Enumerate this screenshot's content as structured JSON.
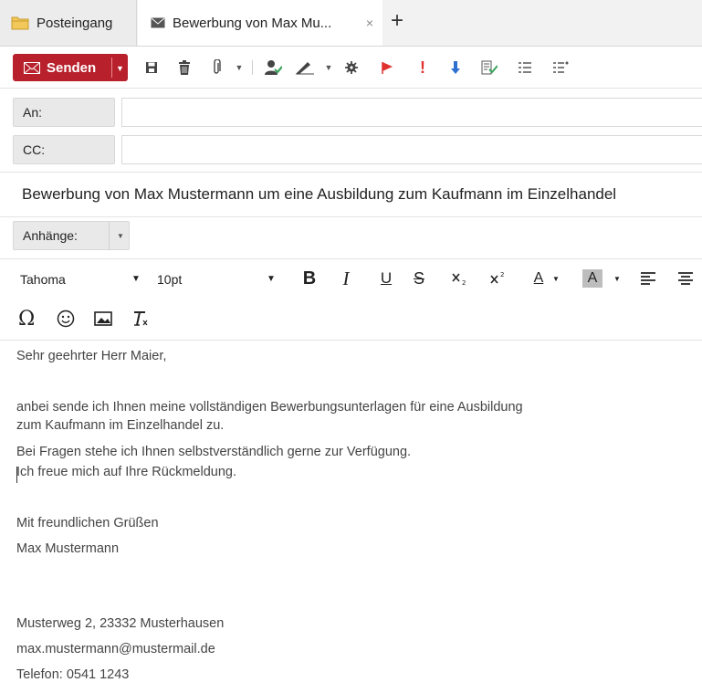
{
  "tabs": [
    {
      "label": "Posteingang",
      "icon": "folder-icon"
    },
    {
      "label": "Bewerbung von Max Mu...",
      "icon": "envelope-icon",
      "close": "×"
    }
  ],
  "new_tab": "+",
  "toolbar": {
    "send_label": "Senden",
    "icons": [
      "save-icon",
      "trash-icon",
      "paperclip-icon",
      "contact-icon",
      "signature-icon",
      "settings-icon",
      "flag-icon",
      "priority-high-icon",
      "priority-low-icon",
      "receipt-icon",
      "list-icon",
      "list-settings-icon"
    ]
  },
  "recipients": {
    "to_label": "An:",
    "to_value": "",
    "cc_label": "CC:",
    "cc_value": ""
  },
  "subject": "Bewerbung von Max Mustermann um eine Ausbildung zum Kaufmann im Einzelhandel",
  "attachments_label": "Anhänge:",
  "editor": {
    "font": "Tahoma",
    "size": "10pt",
    "bold": "B",
    "italic": "I",
    "underline": "U",
    "strike": "S",
    "text_color": "A",
    "bg_color": "A"
  },
  "body": {
    "greeting": "Sehr geehrter Herr Maier,",
    "line1": "anbei sende ich Ihnen meine vollständigen Bewerbungsunterlagen für eine Ausbildung",
    "line2": "zum Kaufmann im Einzelhandel zu.",
    "line3": "Bei Fragen stehe ich Ihnen selbstverständlich gerne zur Verfügung.",
    "line4": "Ich freue mich auf Ihre Rückmeldung.",
    "closing": "Mit freundlichen Grüßen",
    "name": "Max Mustermann",
    "address": "Musterweg 2, 23332 Musterhausen",
    "email": "max.mustermann@mustermail.de",
    "phone": "Telefon: 0541 1243"
  },
  "colors": {
    "send": "#b8212c",
    "flag": "#e0312f",
    "priority_low": "#2f6fd0"
  }
}
